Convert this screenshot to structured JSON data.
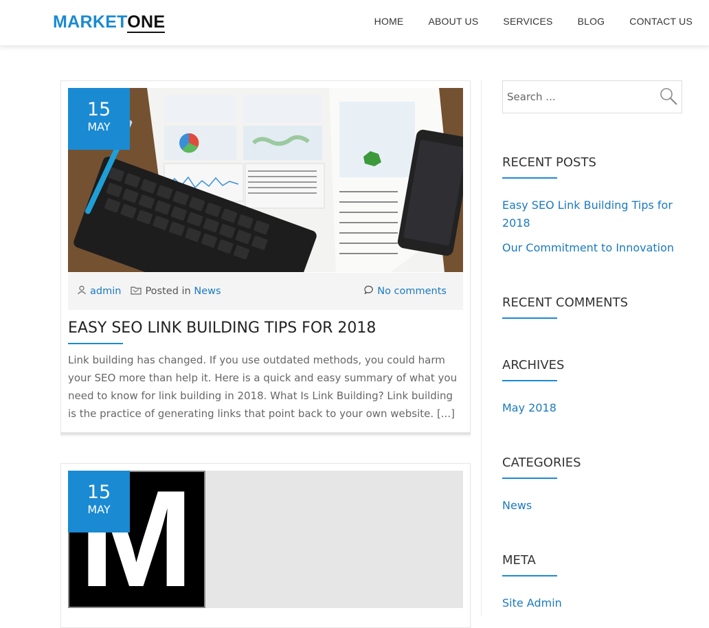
{
  "header": {
    "logo_part1": "MARKET",
    "logo_part2": "ONE",
    "nav": [
      "HOME",
      "ABOUT US",
      "SERVICES",
      "BLOG",
      "CONTACT US"
    ]
  },
  "posts": [
    {
      "day": "15",
      "month": "MAY",
      "author": "admin",
      "posted_in_label": "Posted in",
      "category": "News",
      "comments": "No comments",
      "title": "EASY SEO LINK BUILDING TIPS FOR 2018",
      "excerpt": "Link building has changed. If you use outdated methods, you could harm your SEO more than help it. Here is a quick and easy summary of what you need to know for link building in 2018. What Is Link Building? Link building is the practice of generating links that point back to your own website. [...]"
    },
    {
      "day": "15",
      "month": "MAY",
      "thumb_letter": "M"
    }
  ],
  "sidebar": {
    "search_placeholder": "Search ...",
    "recent_posts_title": "RECENT POSTS",
    "recent_posts": [
      "Easy SEO Link Building Tips for 2018",
      "Our Commitment to Innovation"
    ],
    "recent_comments_title": "RECENT COMMENTS",
    "archives_title": "ARCHIVES",
    "archives": [
      "May 2018"
    ],
    "categories_title": "CATEGORIES",
    "categories": [
      "News"
    ],
    "meta_title": "META",
    "meta_links": [
      "Site Admin"
    ]
  },
  "colors": {
    "accent": "#1a8ad3",
    "link": "#1a7abf"
  },
  "icons": [
    "user-icon",
    "folder-icon",
    "comment-icon",
    "search-icon"
  ]
}
